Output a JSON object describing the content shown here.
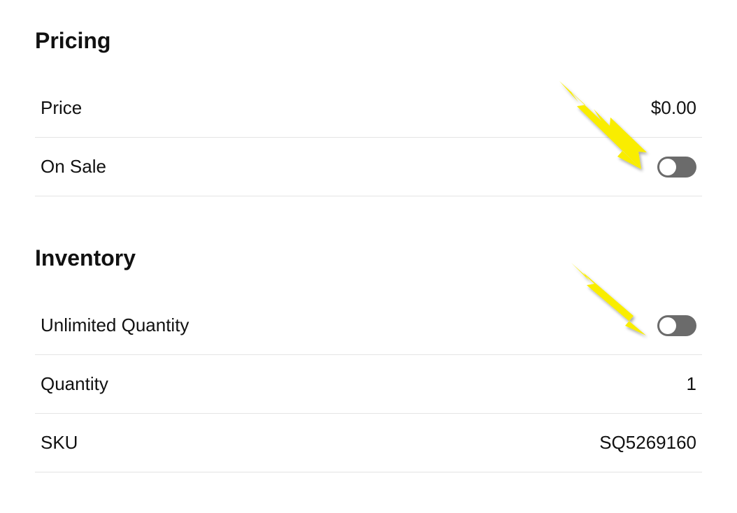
{
  "pricing": {
    "heading": "Pricing",
    "price_label": "Price",
    "price_value": "$0.00",
    "on_sale_label": "On Sale"
  },
  "inventory": {
    "heading": "Inventory",
    "unlimited_label": "Unlimited Quantity",
    "quantity_label": "Quantity",
    "quantity_value": "1",
    "sku_label": "SKU",
    "sku_value": "SQ5269160"
  }
}
